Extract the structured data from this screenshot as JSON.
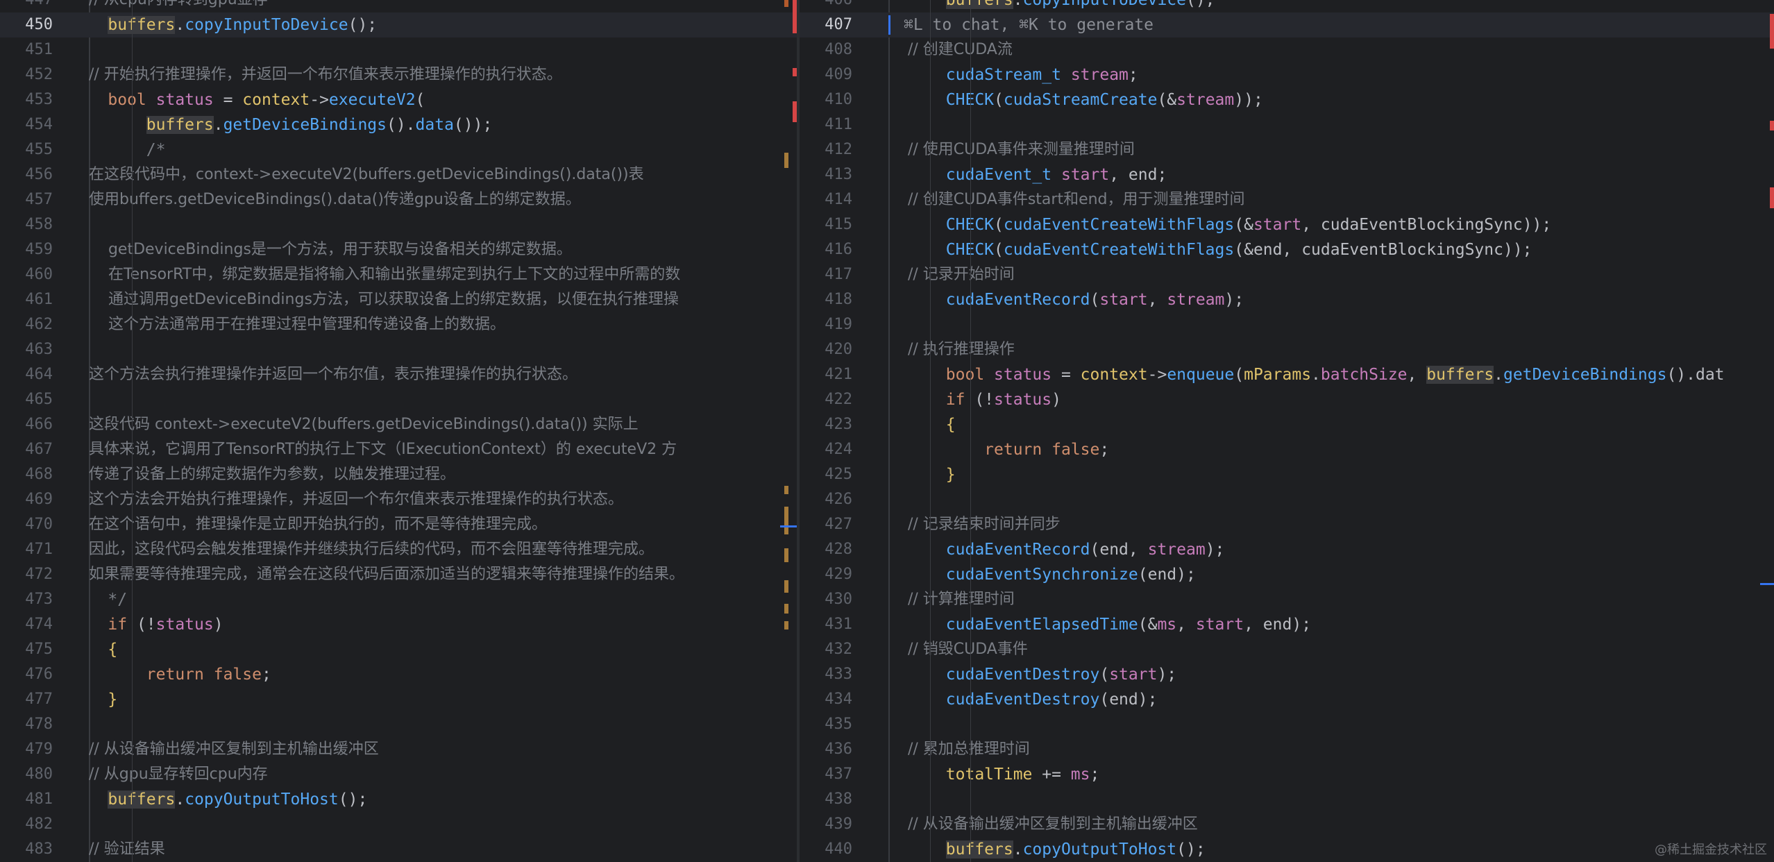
{
  "left_editor": {
    "current_line": "450",
    "lines": [
      {
        "n": "447",
        "t": "    // 从cpu内存转到gpu显存",
        "k": "cmt"
      },
      {
        "n": "450",
        "t": "    buffers.copyInputToDevice();",
        "k": "code"
      },
      {
        "n": "451",
        "t": "",
        "k": "blank"
      },
      {
        "n": "452",
        "t": "    // 开始执行推理操作，并返回一个布尔值来表示推理操作的执行状态。",
        "k": "cmt"
      },
      {
        "n": "453",
        "t": "    bool status = context->executeV2(",
        "k": "code"
      },
      {
        "n": "454",
        "t": "        buffers.getDeviceBindings().data());",
        "k": "code"
      },
      {
        "n": "455",
        "t": "        /*",
        "k": "cmt"
      },
      {
        "n": "456",
        "t": "    在这段代码中，context->executeV2(buffers.getDeviceBindings().data())表",
        "k": "cmt"
      },
      {
        "n": "457",
        "t": "    使用buffers.getDeviceBindings().data()传递gpu设备上的绑定数据。",
        "k": "cmt"
      },
      {
        "n": "458",
        "t": "",
        "k": "blank"
      },
      {
        "n": "459",
        "t": "        getDeviceBindings是一个方法，用于获取与设备相关的绑定数据。",
        "k": "cmt"
      },
      {
        "n": "460",
        "t": "        在TensorRT中，绑定数据是指将输入和输出张量绑定到执行上下文的过程中所需的数",
        "k": "cmt"
      },
      {
        "n": "461",
        "t": "        通过调用getDeviceBindings方法，可以获取设备上的绑定数据，以便在执行推理操",
        "k": "cmt"
      },
      {
        "n": "462",
        "t": "        这个方法通常用于在推理过程中管理和传递设备上的数据。",
        "k": "cmt"
      },
      {
        "n": "463",
        "t": "",
        "k": "blank"
      },
      {
        "n": "464",
        "t": "    这个方法会执行推理操作并返回一个布尔值，表示推理操作的执行状态。",
        "k": "cmt"
      },
      {
        "n": "465",
        "t": "",
        "k": "blank"
      },
      {
        "n": "466",
        "t": "    这段代码 context->executeV2(buffers.getDeviceBindings().data()) 实际上",
        "k": "cmt"
      },
      {
        "n": "467",
        "t": "    具体来说，它调用了TensorRT的执行上下文（IExecutionContext）的 executeV2 方",
        "k": "cmt"
      },
      {
        "n": "468",
        "t": "    传递了设备上的绑定数据作为参数，以触发推理过程。",
        "k": "cmt"
      },
      {
        "n": "469",
        "t": "    这个方法会开始执行推理操作，并返回一个布尔值来表示推理操作的执行状态。",
        "k": "cmt"
      },
      {
        "n": "470",
        "t": "    在这个语句中，推理操作是立即开始执行的，而不是等待推理完成。",
        "k": "cmt"
      },
      {
        "n": "471",
        "t": "    因此，这段代码会触发推理操作并继续执行后续的代码，而不会阻塞等待推理完成。",
        "k": "cmt"
      },
      {
        "n": "472",
        "t": "    如果需要等待推理完成，通常会在这段代码后面添加适当的逻辑来等待推理操作的结果。",
        "k": "cmt"
      },
      {
        "n": "473",
        "t": "    */",
        "k": "cmt"
      },
      {
        "n": "474",
        "t": "    if (!status)",
        "k": "code"
      },
      {
        "n": "475",
        "t": "    {",
        "k": "code"
      },
      {
        "n": "476",
        "t": "        return false;",
        "k": "code"
      },
      {
        "n": "477",
        "t": "    }",
        "k": "code"
      },
      {
        "n": "478",
        "t": "",
        "k": "blank"
      },
      {
        "n": "479",
        "t": "    // 从设备输出缓冲区复制到主机输出缓冲区",
        "k": "cmt"
      },
      {
        "n": "480",
        "t": "    // 从gpu显存转回cpu内存",
        "k": "cmt"
      },
      {
        "n": "481",
        "t": "    buffers.copyOutputToHost();",
        "k": "code"
      },
      {
        "n": "482",
        "t": "",
        "k": "blank"
      },
      {
        "n": "483",
        "t": "    // 验证结果",
        "k": "cmt"
      }
    ]
  },
  "right_editor": {
    "current_line": "407",
    "hint_text": "⌘L to chat, ⌘K to generate",
    "lines": [
      {
        "n": "406",
        "t": "        buffers.copyInputToDevice();",
        "k": "code"
      },
      {
        "n": "407",
        "t": "",
        "k": "hint"
      },
      {
        "n": "408",
        "t": "        // 创建CUDA流",
        "k": "cmt"
      },
      {
        "n": "409",
        "t": "        cudaStream_t stream;",
        "k": "code"
      },
      {
        "n": "410",
        "t": "        CHECK(cudaStreamCreate(&stream));",
        "k": "code"
      },
      {
        "n": "411",
        "t": "",
        "k": "blank"
      },
      {
        "n": "412",
        "t": "        // 使用CUDA事件来测量推理时间",
        "k": "cmt"
      },
      {
        "n": "413",
        "t": "        cudaEvent_t start, end;",
        "k": "code"
      },
      {
        "n": "414",
        "t": "        // 创建CUDA事件start和end，用于测量推理时间",
        "k": "cmt"
      },
      {
        "n": "415",
        "t": "        CHECK(cudaEventCreateWithFlags(&start, cudaEventBlockingSync));",
        "k": "code"
      },
      {
        "n": "416",
        "t": "        CHECK(cudaEventCreateWithFlags(&end, cudaEventBlockingSync));",
        "k": "code"
      },
      {
        "n": "417",
        "t": "        // 记录开始时间",
        "k": "cmt"
      },
      {
        "n": "418",
        "t": "        cudaEventRecord(start, stream);",
        "k": "code"
      },
      {
        "n": "419",
        "t": "",
        "k": "blank"
      },
      {
        "n": "420",
        "t": "        // 执行推理操作",
        "k": "cmt"
      },
      {
        "n": "421",
        "t": "        bool status = context->enqueue(mParams.batchSize, buffers.getDeviceBindings().dat",
        "k": "code"
      },
      {
        "n": "422",
        "t": "        if (!status)",
        "k": "code"
      },
      {
        "n": "423",
        "t": "        {",
        "k": "code"
      },
      {
        "n": "424",
        "t": "            return false;",
        "k": "code"
      },
      {
        "n": "425",
        "t": "        }",
        "k": "code"
      },
      {
        "n": "426",
        "t": "",
        "k": "blank"
      },
      {
        "n": "427",
        "t": "        // 记录结束时间并同步",
        "k": "cmt"
      },
      {
        "n": "428",
        "t": "        cudaEventRecord(end, stream);",
        "k": "code"
      },
      {
        "n": "429",
        "t": "        cudaEventSynchronize(end);",
        "k": "code"
      },
      {
        "n": "430",
        "t": "        // 计算推理时间",
        "k": "cmt"
      },
      {
        "n": "431",
        "t": "        cudaEventElapsedTime(&ms, start, end);",
        "k": "code"
      },
      {
        "n": "432",
        "t": "        // 销毁CUDA事件",
        "k": "cmt"
      },
      {
        "n": "433",
        "t": "        cudaEventDestroy(start);",
        "k": "code"
      },
      {
        "n": "434",
        "t": "        cudaEventDestroy(end);",
        "k": "code"
      },
      {
        "n": "435",
        "t": "",
        "k": "blank"
      },
      {
        "n": "436",
        "t": "        // 累加总推理时间",
        "k": "cmt"
      },
      {
        "n": "437",
        "t": "        totalTime += ms;",
        "k": "code"
      },
      {
        "n": "438",
        "t": "",
        "k": "blank"
      },
      {
        "n": "439",
        "t": "        // 从设备输出缓冲区复制到主机输出缓冲区",
        "k": "cmt"
      },
      {
        "n": "440",
        "t": "        buffers.copyOutputToHost();",
        "k": "code"
      }
    ]
  },
  "watermark": "@稀土掘金技术社区",
  "colors": {
    "background": "#1e1f22",
    "comment": "#7a7e85",
    "keyword": "#cf8e6d",
    "function": "#56a8f5",
    "variable": "#c77dbb",
    "member": "#e0c36b",
    "line_number": "#5f636b",
    "accent": "#3574f0"
  }
}
